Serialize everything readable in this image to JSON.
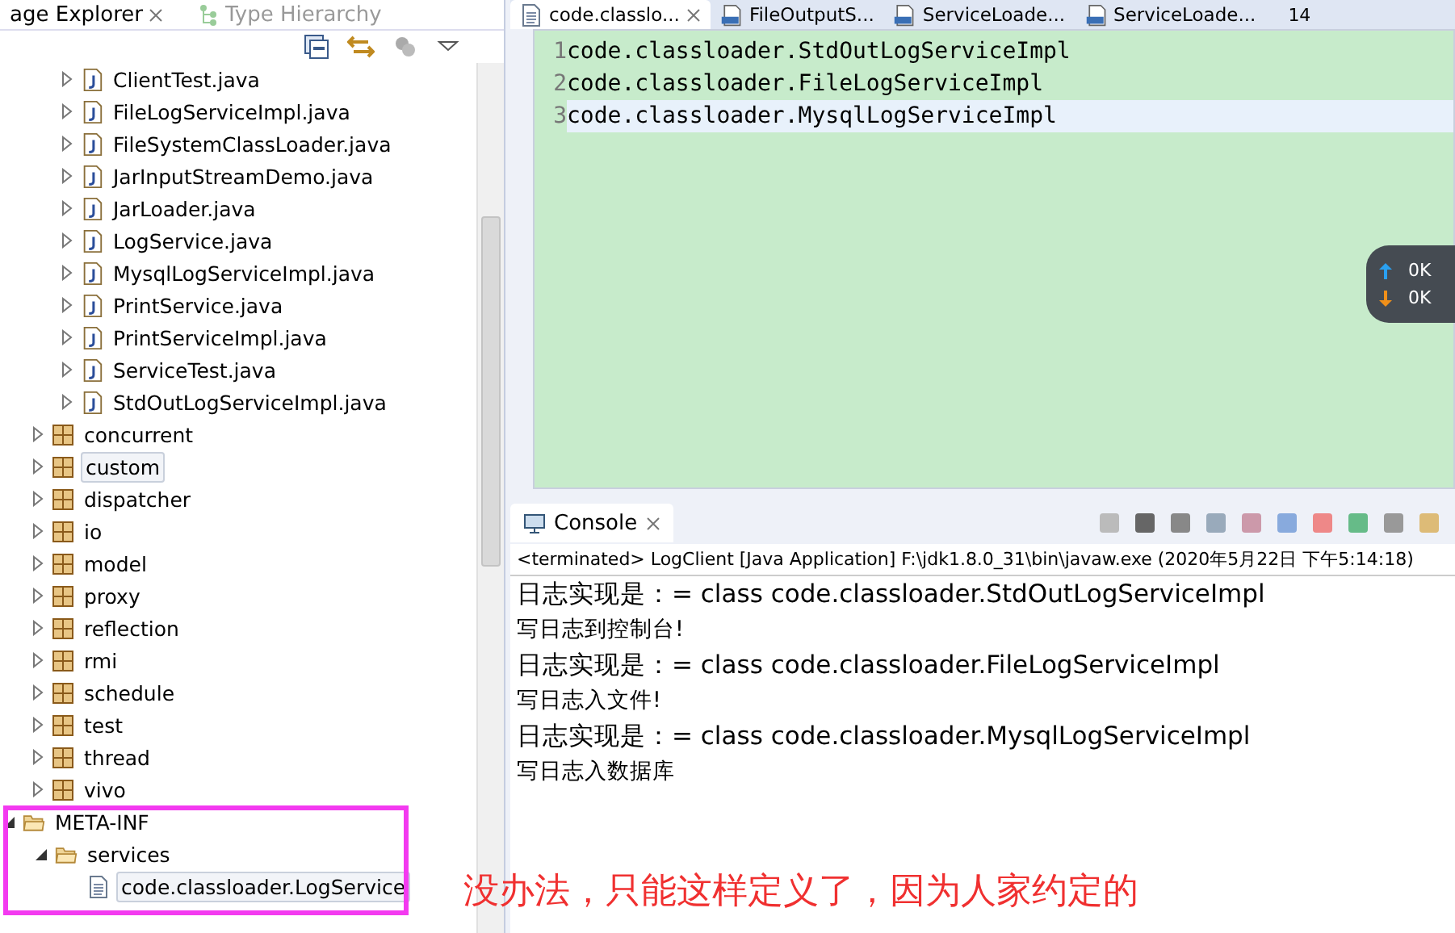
{
  "explorer": {
    "tabs": [
      {
        "label": "age Explorer",
        "selected": true
      },
      {
        "label": "Type Hierarchy",
        "selected": false
      }
    ],
    "tree": [
      {
        "label": "ClientTest.java",
        "kind": "java",
        "selected": false
      },
      {
        "label": "FileLogServiceImpl.java",
        "kind": "java",
        "selected": false
      },
      {
        "label": "FileSystemClassLoader.java",
        "kind": "java",
        "selected": false
      },
      {
        "label": "JarInputStreamDemo.java",
        "kind": "java",
        "selected": false
      },
      {
        "label": "JarLoader.java",
        "kind": "java",
        "selected": false
      },
      {
        "label": "LogService.java",
        "kind": "java",
        "selected": false
      },
      {
        "label": "MysqlLogServiceImpl.java",
        "kind": "java",
        "selected": false
      },
      {
        "label": "PrintService.java",
        "kind": "java",
        "selected": false
      },
      {
        "label": "PrintServiceImpl.java",
        "kind": "java",
        "selected": false
      },
      {
        "label": "ServiceTest.java",
        "kind": "java",
        "selected": false
      },
      {
        "label": "StdOutLogServiceImpl.java",
        "kind": "java",
        "selected": false
      }
    ],
    "packages": [
      {
        "label": "concurrent",
        "selected": false
      },
      {
        "label": "custom",
        "selected": true
      },
      {
        "label": "dispatcher",
        "selected": false
      },
      {
        "label": "io",
        "selected": false
      },
      {
        "label": "model",
        "selected": false
      },
      {
        "label": "proxy",
        "selected": false
      },
      {
        "label": "reflection",
        "selected": false
      },
      {
        "label": "rmi",
        "selected": false
      },
      {
        "label": "schedule",
        "selected": false
      },
      {
        "label": "test",
        "selected": false
      },
      {
        "label": "thread",
        "selected": false
      },
      {
        "label": "vivo",
        "selected": false
      }
    ],
    "folders": [
      {
        "label": "META-INF",
        "kind": "folder",
        "expanded": true,
        "selected": false,
        "children": [
          {
            "label": "services",
            "kind": "folder",
            "expanded": true,
            "selected": false,
            "children": [
              {
                "label": "code.classloader.LogService",
                "kind": "file",
                "selected": true
              }
            ]
          }
        ]
      }
    ]
  },
  "editor": {
    "tabs": [
      {
        "label": "code.classlo...",
        "kind": "text",
        "selected": true
      },
      {
        "label": "FileOutputS...",
        "kind": "class",
        "selected": false
      },
      {
        "label": "ServiceLoade...",
        "kind": "class",
        "selected": false
      },
      {
        "label": "ServiceLoade...",
        "kind": "class",
        "selected": false
      }
    ],
    "overflow_count": "14",
    "lines": [
      {
        "number": "1",
        "text": "code.classloader.StdOutLogServiceImpl",
        "current": false
      },
      {
        "number": "2",
        "text": "code.classloader.FileLogServiceImpl",
        "current": false
      },
      {
        "number": "3",
        "text": "code.classloader.MysqlLogServiceImpl",
        "current": true
      }
    ]
  },
  "speed_widget": {
    "upload": "0K",
    "download": "0K"
  },
  "console": {
    "title": "Console",
    "status": "<terminated> LogClient [Java Application] F:\\jdk1.8.0_31\\bin\\javaw.exe (2020年5月22日 下午5:14:18)",
    "lines": [
      "日志实现是：= class code.classloader.StdOutLogServiceImpl",
      "写日志到控制台!",
      "日志实现是：= class code.classloader.FileLogServiceImpl",
      "写日志入文件!",
      "日志实现是：= class code.classloader.MysqlLogServiceImpl",
      "写日志入数据库"
    ]
  },
  "annotation": "没办法，只能这样定义了，因为人家约定的"
}
